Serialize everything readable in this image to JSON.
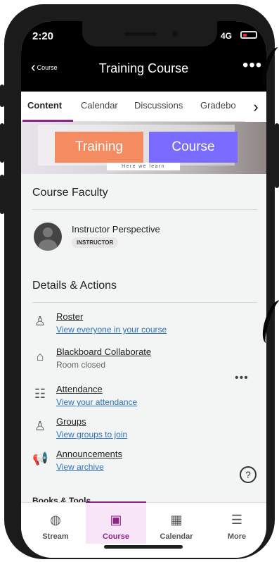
{
  "status": {
    "time": "2:20",
    "signal": "4G"
  },
  "header": {
    "back_label": "Course",
    "title": "Training Course",
    "more": "•••"
  },
  "tabs": [
    {
      "label": "Content"
    },
    {
      "label": "Calendar"
    },
    {
      "label": "Discussions"
    },
    {
      "label": "Gradebo"
    }
  ],
  "banner": {
    "left": "Training",
    "right": "Course",
    "tagline": "Here we learn"
  },
  "faculty": {
    "title": "Course Faculty",
    "name": "Instructor Perspective",
    "role": "INSTRUCTOR"
  },
  "details": {
    "title": "Details & Actions",
    "items": [
      {
        "title": "Roster",
        "subtitle": "View everyone in your course",
        "icon": "roster-icon"
      },
      {
        "title": "Blackboard Collaborate",
        "subtitle": "Room closed",
        "icon": "collaborate-icon"
      },
      {
        "title": "Attendance",
        "subtitle": "View your attendance",
        "icon": "attendance-icon"
      },
      {
        "title": "Groups",
        "subtitle": "View groups to join",
        "icon": "groups-icon"
      },
      {
        "title": "Announcements",
        "subtitle": "View archive",
        "icon": "announcements-icon"
      },
      {
        "title": "Books & Tools",
        "subtitle": "",
        "icon": "tools-icon"
      }
    ],
    "row_more": "•••"
  },
  "bottom_nav": [
    {
      "label": "Stream",
      "icon": "globe-icon"
    },
    {
      "label": "Course",
      "icon": "course-icon"
    },
    {
      "label": "Calendar",
      "icon": "calendar-icon"
    },
    {
      "label": "More",
      "icon": "menu-icon"
    }
  ],
  "help": "?",
  "colors": {
    "accent": "#8d2488",
    "link": "#2e73b8",
    "banner_orange": "#f58b61",
    "banner_purple": "#7a6cff"
  }
}
